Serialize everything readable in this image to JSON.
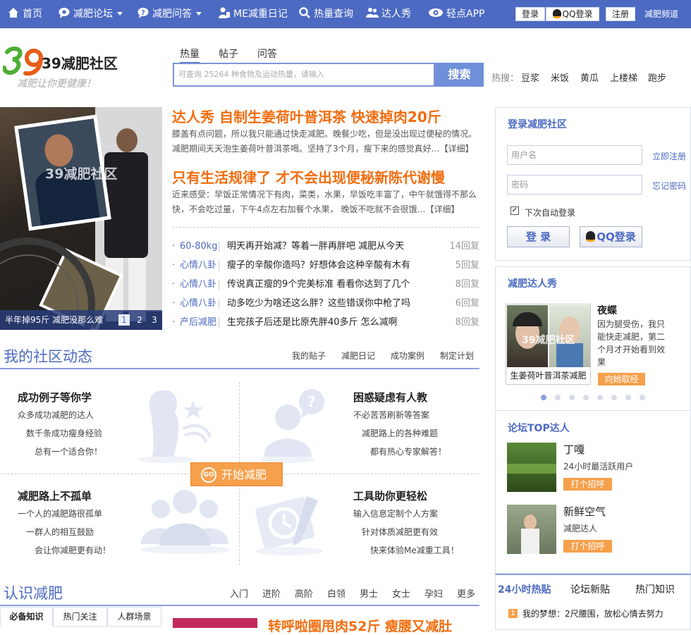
{
  "topnav": {
    "items": [
      {
        "label": "首页",
        "icon": "home-icon"
      },
      {
        "label": "减肥论坛",
        "icon": "chat-bubble-icon",
        "caret": true
      },
      {
        "label": "减肥问答",
        "icon": "question-bubble-icon",
        "caret": true
      },
      {
        "label": "ME减重日记",
        "icon": "user-diary-icon"
      },
      {
        "label": "热量查询",
        "icon": "search-icon"
      },
      {
        "label": "达人秀",
        "icon": "people-icon"
      },
      {
        "label": "轻点APP",
        "icon": "eye-app-icon"
      }
    ],
    "login": "登录",
    "qq_login": "QQ登录",
    "register": "注册",
    "channel": "减肥频道"
  },
  "logo": {
    "text": "39减肥社区",
    "slogan": "减肥让你更健康！"
  },
  "search": {
    "tabs": [
      "热量",
      "帖子",
      "问答"
    ],
    "placeholder": "可查询 25264 种食物及运动热量，请输入",
    "button": "搜索",
    "hot_label": "热搜：",
    "hot_items": [
      "豆浆",
      "米饭",
      "黄瓜",
      "上楼梯",
      "跑步"
    ]
  },
  "slider": {
    "caption": "半年掉95斤 减肥没那么难",
    "pages": [
      "1",
      "2",
      "3"
    ],
    "watermark": "39减肥社区"
  },
  "featured": [
    {
      "title": "达人秀 自制生姜荷叶普洱茶 快速掉肉20斤",
      "text1": "膝盖有点问题，所以我只能通过快走减肥。晚餐少吃，但是没出现过便秘的情况。",
      "text2": "减肥期间天天泡生姜荷叶普洱茶喝。坚持了3个月，瘦下来的感觉真好…【详细】"
    },
    {
      "title": "只有生活规律了 才不会出现便秘新陈代谢慢",
      "text1": "近来感受：早饭正常情况下有肉，菜类，水果，早饭吃丰富了，中午就饿得不那么",
      "text2": "快，不会吃过量，下午4点左右加餐个水果， 晚饭不吃就不会很饿…【详细】"
    }
  ],
  "forum_rows": [
    {
      "cat": "60-80kg",
      "title": "明天再开始减？等着一胖再胖吧  减肥从今天",
      "replies": "14回复"
    },
    {
      "cat": "心情八卦",
      "title": "瘦子的辛酸你造吗？好想体会这种辛酸有木有",
      "replies": "5回复"
    },
    {
      "cat": "心情八卦",
      "title": "传说真正瘦的9个完美标准  看看你达到了几个",
      "replies": "8回复"
    },
    {
      "cat": "心情八卦",
      "title": "动多吃少为啥还这么胖？这些错误你中枪了吗",
      "replies": "6回复"
    },
    {
      "cat": "产后减肥",
      "title": "生完孩子后还是比原先胖40多斤  怎么减啊",
      "replies": "8回复"
    }
  ],
  "community": {
    "title": "我的社区动态",
    "links": [
      "我的贴子",
      "减肥日记",
      "成功案例",
      "制定计划"
    ],
    "cells": [
      {
        "title": "成功例子等你学",
        "lines": [
          "众多成功减肥的达人",
          "数千条成功瘦身经验",
          "总有一个适合你！"
        ]
      },
      {
        "title": "困惑疑虑有人教",
        "lines": [
          "不必苦苦刷新等答案",
          "减肥路上的各种难题",
          "都有热心专家解答！"
        ]
      },
      {
        "title": "减肥路上不孤单",
        "lines": [
          "一个人的减肥路很孤单",
          "一群人的相互鼓励",
          "会让你减肥更有动！"
        ]
      },
      {
        "title": "工具助你更轻松",
        "lines": [
          "输入信息定制个人方案",
          "针对体质减肥更有效",
          "快来体验Me减重工具！"
        ]
      }
    ],
    "start_button": "开始减肥",
    "start_icon": "GO"
  },
  "know": {
    "title": "认识减肥",
    "links": [
      "入门",
      "进阶",
      "高阶",
      "白领",
      "男士",
      "女士",
      "孕妇",
      "更多"
    ],
    "tabs": [
      "必备知识",
      "热门关注",
      "人群场景"
    ],
    "headline": "转呼啦圈甩肉52斤 瘦腰又减肚"
  },
  "login_panel": {
    "title": "登录减肥社区",
    "username": "用户名",
    "password": "密码",
    "register_now": "立即注册",
    "forgot": "忘记密码",
    "remember": "下次自动登录",
    "login_btn": "登 录",
    "qq_btn": "QQ登录"
  },
  "show_panel": {
    "title": "减肥达人秀",
    "caption": "生姜荷叶普洱茶减肥",
    "watermark": "39减肥社区",
    "name": "夜蝶",
    "desc": "因为腿受伤，我只能快走减肥，第二个月才开始看到效果",
    "button": "向她取经",
    "dots": 8,
    "active_dot": 0
  },
  "top_panel": {
    "title": "论坛TOP达人",
    "users": [
      {
        "name": "丁嘎",
        "desc": "24小时最活跃用户",
        "button": "打个招呼"
      },
      {
        "name": "新鲜空气",
        "desc": "减肥达人",
        "button": "打个招呼"
      }
    ]
  },
  "hot_panel": {
    "tabs": [
      "24小时热贴",
      "论坛新贴",
      "热门知识"
    ],
    "items": [
      {
        "rank": "1",
        "text": "我的梦想：2尺腰围，放松心情去努力"
      }
    ]
  },
  "colors": {
    "brand_blue": "#4c6ac2",
    "orange": "#f26d0f",
    "button_orange": "#f6a04c"
  }
}
